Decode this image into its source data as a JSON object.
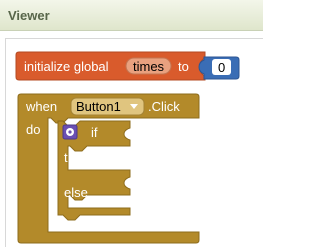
{
  "panel": {
    "title": "Viewer"
  },
  "global_block": {
    "prefix": "initialize global",
    "var_name": "times",
    "to_label": "to",
    "value": "0",
    "color": "#d95b2c",
    "field_color": "#e9a17f",
    "number_color": "#3a6db5"
  },
  "event_block": {
    "when_label": "when",
    "component": "Button1",
    "event": ".Click",
    "do_label": "do",
    "color": "#b38a2a"
  },
  "if_block": {
    "if_label": "if",
    "then_label": "then",
    "else_label": "else",
    "icon": "gear-icon"
  }
}
